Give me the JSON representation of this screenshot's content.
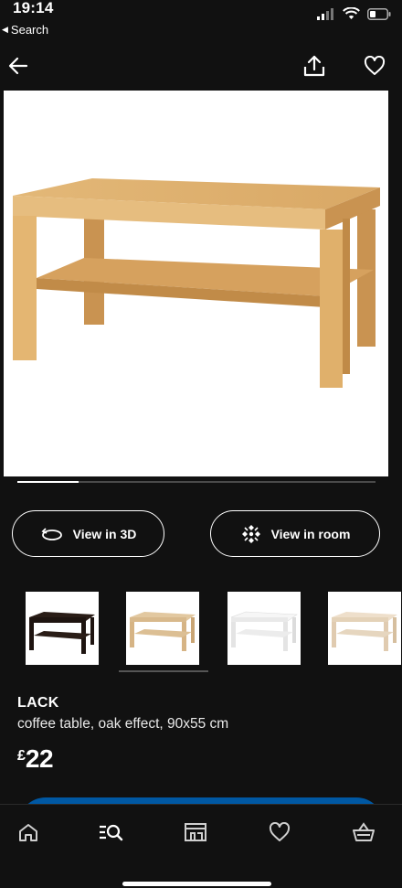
{
  "status_bar": {
    "time": "19:14",
    "back_app_label": "Search"
  },
  "nav": {
    "back_icon": "arrow-left-icon",
    "share_icon": "share-icon",
    "favorite_icon": "heart-icon"
  },
  "gallery": {
    "image_count_indicator": 0.17
  },
  "actions": {
    "view_3d_label": "View in 3D",
    "view_room_label": "View in room"
  },
  "variants": [
    {
      "name": "black-brown"
    },
    {
      "name": "oak effect",
      "selected": true
    },
    {
      "name": "white"
    },
    {
      "name": "white stained oak effect"
    }
  ],
  "product": {
    "name": "LACK",
    "description": "coffee table, oak effect, 90x55 cm",
    "currency": "£",
    "price": "22"
  },
  "tab_bar": [
    "home-icon",
    "search-icon",
    "store-icon",
    "heart-icon",
    "basket-icon"
  ],
  "colors": {
    "background": "#111111",
    "accent": "#0058a3",
    "oak": "#d9a865"
  }
}
